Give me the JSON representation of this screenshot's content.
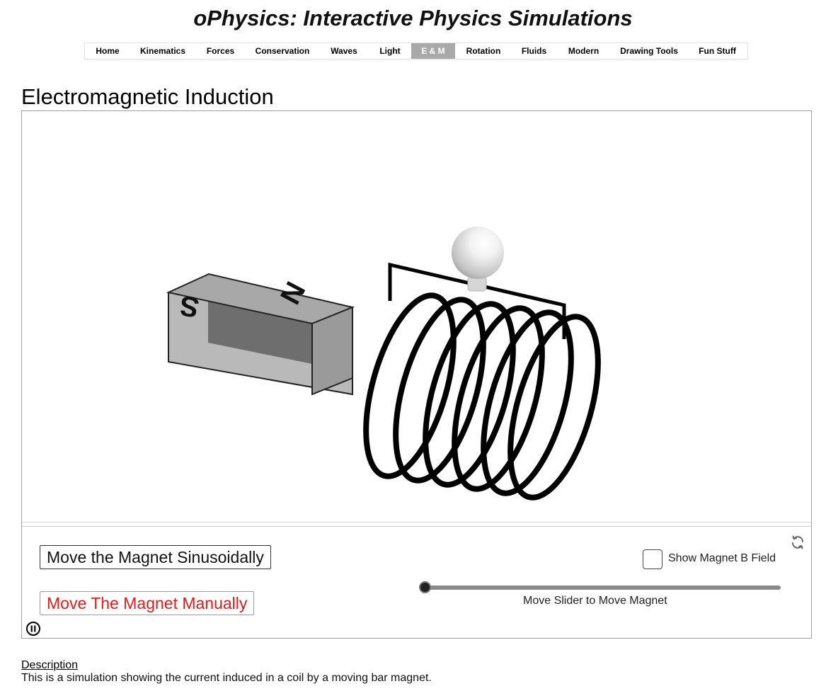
{
  "site": {
    "title": "oPhysics: Interactive Physics Simulations"
  },
  "nav": {
    "active": "E & M",
    "items": [
      "Home",
      "Kinematics",
      "Forces",
      "Conservation",
      "Waves",
      "Light",
      "E & M",
      "Rotation",
      "Fluids",
      "Modern",
      "Drawing Tools",
      "Fun Stuff"
    ]
  },
  "page": {
    "title": "Electromagnetic Induction"
  },
  "sim": {
    "magnet_labels": {
      "south": "S",
      "north": "N"
    },
    "buttons": {
      "sinusoidal": "Move the Magnet Sinusoidally",
      "manual": "Move The Magnet Manually"
    },
    "checkbox": {
      "label": "Show Magnet B Field",
      "checked": false
    },
    "slider": {
      "caption": "Move Slider to Move Magnet",
      "value": 0
    },
    "icons": {
      "refresh": "refresh-icon",
      "pause": "pause-icon"
    }
  },
  "description": {
    "link": "Description",
    "text": "This is a simulation showing the current induced in a coil by a moving bar magnet."
  },
  "colors": {
    "nav_active_bg": "#a9a9a9",
    "manual_button_text": "#e01b1b",
    "magnet": "#b9b9b9"
  }
}
